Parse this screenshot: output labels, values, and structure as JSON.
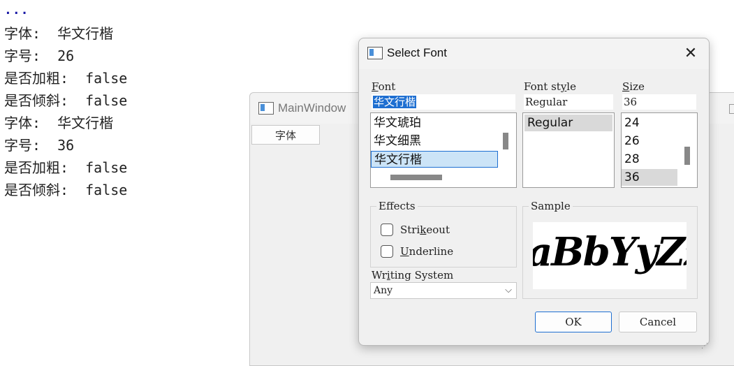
{
  "console": {
    "dots": "...",
    "lines": [
      "字体:  华文行楷",
      "字号:  26",
      "是否加粗:  false",
      "是否倾斜:  false",
      "字体:  华文行楷",
      "字号:  36",
      "是否加粗:  false",
      "是否倾斜:  false"
    ]
  },
  "main_window": {
    "title": "MainWindow",
    "font_button": "字体"
  },
  "dialog": {
    "title": "Select Font",
    "close": "✕",
    "font_label_pre": "",
    "font_label_u": "F",
    "font_label_post": "ont",
    "font_value": "华文行楷",
    "font_items": [
      "华文琥珀",
      "华文细黑",
      "华文行楷"
    ],
    "style_label_pre": "Font st",
    "style_label_u": "y",
    "style_label_post": "le",
    "style_value": "Regular",
    "style_items": [
      "Regular"
    ],
    "size_label_pre": "",
    "size_label_u": "S",
    "size_label_post": "ize",
    "size_value": "36",
    "size_items": [
      "24",
      "26",
      "28",
      "36"
    ],
    "effects_title": "Effects",
    "strikeout_pre": "Stri",
    "strikeout_u": "k",
    "strikeout_post": "eout",
    "underline_pre": "",
    "underline_u": "U",
    "underline_post": "nderline",
    "writing_label_pre": "Wr",
    "writing_label_u": "i",
    "writing_label_post": "ting System",
    "writing_value": "Any",
    "sample_title": "Sample",
    "sample_text": "aBbYyZz",
    "ok": "OK",
    "cancel": "Cancel"
  },
  "icons": {
    "chevron": "⌵",
    "grip": "⋰"
  }
}
